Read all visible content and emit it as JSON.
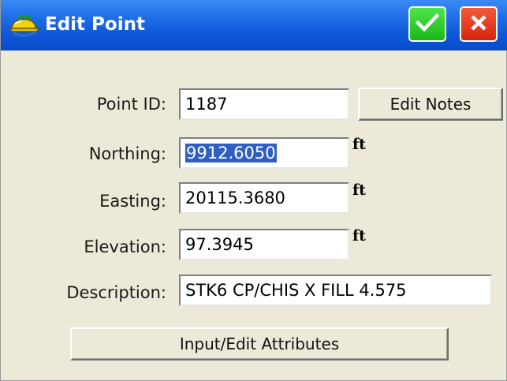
{
  "window": {
    "title": "Edit Point",
    "app_icon": "hardhat-icon",
    "ok_icon": "checkmark-icon",
    "close_icon": "close-icon",
    "colors": {
      "title_bar": "#0d56d8",
      "ok_button": "#19b815",
      "close_button": "#d8230d",
      "background": "#ece9d8"
    }
  },
  "form": {
    "point_id": {
      "label": "Point ID:",
      "value": "1187"
    },
    "northing": {
      "label": "Northing:",
      "value": "9912.6050",
      "unit": "ft"
    },
    "easting": {
      "label": "Easting:",
      "value": "20115.3680",
      "unit": "ft"
    },
    "elevation": {
      "label": "Elevation:",
      "value": "97.3945",
      "unit": "ft"
    },
    "description": {
      "label": "Description:",
      "value": "STK6 CP/CHIS X FILL 4.575"
    }
  },
  "buttons": {
    "edit_notes": "Edit Notes",
    "input_edit_attributes": "Input/Edit Attributes"
  }
}
